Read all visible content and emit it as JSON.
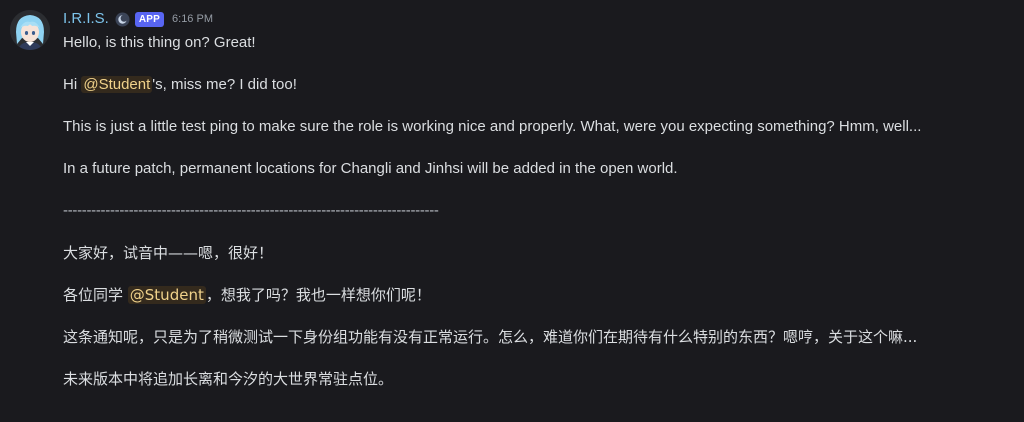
{
  "message": {
    "author": "I.R.I.S.",
    "app_tag": "APP",
    "timestamp": "6:16 PM",
    "badge_icon": "moon-badge-icon",
    "avatar_icon": "character-avatar"
  },
  "content": {
    "line1": "Hello, is this thing on? Great!",
    "line2_pre": "Hi ",
    "line2_mention": "@Student",
    "line2_post": "'s, miss me? I did too!",
    "line3": "This is just a little test ping to make sure the role is working nice and properly. What, were you expecting something? Hmm, well...",
    "line4": "In a future patch, permanent locations for Changli and Jinhsi will be added in the open world.",
    "divider": "--------------------------------------------------------------------------------",
    "cn1": "大家好，试音中——嗯，很好！",
    "cn2_pre": "各位同学 ",
    "cn2_mention": "@Student",
    "cn2_post": "，想我了吗？我也一样想你们呢！",
    "cn3": "这条通知呢，只是为了稍微测试一下身份组功能有没有正常运行。怎么，难道你们在期待有什么特别的东西？嗯哼，关于这个嘛...",
    "cn4": "未来版本中将追加长离和今汐的大世界常驻点位。"
  },
  "colors": {
    "background": "#1a1a1e",
    "username": "#7cc3ea",
    "app_tag": "#5865f2",
    "mention_bg": "rgba(250,168,26,0.12)",
    "mention_text": "#f0d28b"
  }
}
